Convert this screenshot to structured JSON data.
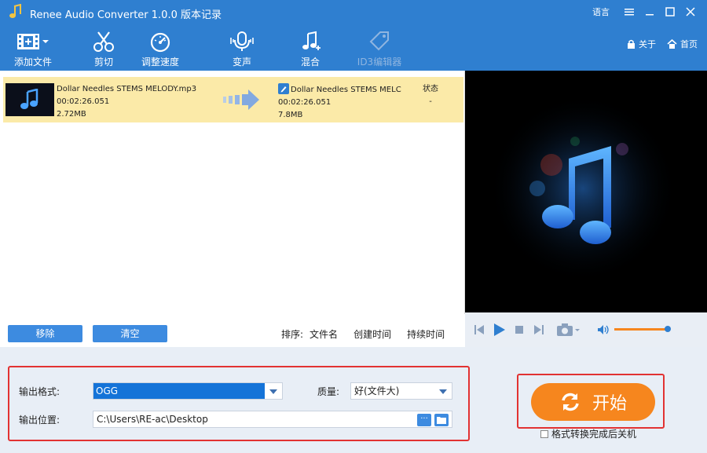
{
  "window": {
    "title": "Renee Audio Converter 1.0.0 版本记录",
    "language_label": "语言"
  },
  "toolbar": {
    "items": [
      {
        "label": "添加文件",
        "icon": "film-add-icon"
      },
      {
        "label": "剪切",
        "icon": "scissors-icon"
      },
      {
        "label": "调整速度",
        "icon": "speedometer-icon"
      },
      {
        "label": "变声",
        "icon": "microphone-icon"
      },
      {
        "label": "混合",
        "icon": "music-mix-icon"
      },
      {
        "label": "ID3编辑器",
        "icon": "tag-icon",
        "disabled": true
      }
    ],
    "about_label": "关于",
    "home_label": "首页"
  },
  "file_list": {
    "rows": [
      {
        "source_name": "Dollar Needles STEMS MELODY.mp3",
        "source_duration": "00:02:26.051",
        "source_size": "2.72MB",
        "output_name": "Dollar Needles STEMS MELC",
        "output_duration": "00:02:26.051",
        "output_size": "7.8MB",
        "status_label": "状态",
        "status_value": "-"
      }
    ]
  },
  "list_controls": {
    "remove_label": "移除",
    "clear_label": "清空",
    "sort_label": "排序:",
    "sort_options": [
      "文件名",
      "创建时间",
      "持续时间"
    ]
  },
  "settings": {
    "format_label": "输出格式:",
    "format_value": "OGG",
    "quality_label": "质量:",
    "quality_value": "好(文件大)",
    "location_label": "输出位置:",
    "location_value": "C:\\Users\\RE-ac\\Desktop",
    "browse_label": "···"
  },
  "start": {
    "label": "开始",
    "shutdown_label": "格式转换完成后关机"
  },
  "colors": {
    "brand": "#2f7fd0",
    "start": "#f6861e",
    "highlight_row": "#fbeaa8",
    "annotation": "#e23232"
  }
}
